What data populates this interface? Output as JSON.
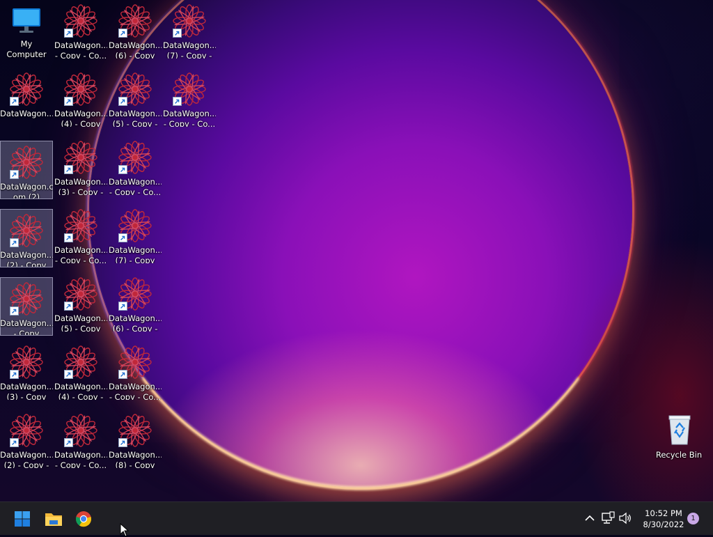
{
  "desktop": {
    "icons": [
      {
        "name": "my-computer-icon",
        "label": "My Computer",
        "type": "monitor"
      },
      {
        "name": "datawagon-shortcut-icon",
        "label": "DataWagon....\n- Copy - Co...",
        "type": "shortcut"
      },
      {
        "name": "datawagon-shortcut-icon",
        "label": "DataWagon....\n(6) - Copy",
        "type": "shortcut"
      },
      {
        "name": "datawagon-shortcut-icon",
        "label": "DataWagon....\n(7) - Copy - ...",
        "type": "shortcut"
      },
      {
        "name": "datawagon-shortcut-icon",
        "label": "DataWagon...",
        "type": "shortcut"
      },
      {
        "name": "datawagon-shortcut-icon",
        "label": "DataWagon....\n(4) - Copy",
        "type": "shortcut"
      },
      {
        "name": "datawagon-shortcut-icon",
        "label": "DataWagon....\n(5) - Copy - ...",
        "type": "shortcut"
      },
      {
        "name": "datawagon-shortcut-icon",
        "label": "DataWagon....\n- Copy - Co...",
        "type": "shortcut"
      },
      {
        "name": "datawagon-shortcut-icon",
        "label": "DataWagon.c\nom (2)",
        "type": "shortcut",
        "selected": true
      },
      {
        "name": "datawagon-shortcut-icon",
        "label": "DataWagon....\n(3) - Copy - ...",
        "type": "shortcut"
      },
      {
        "name": "datawagon-shortcut-icon",
        "label": "DataWagon....\n- Copy - Co...",
        "type": "shortcut"
      },
      {
        "name": "datawagon-shortcut-icon",
        "label": "DataWagon....\n(2) - Copy",
        "type": "shortcut",
        "selected": true
      },
      {
        "name": "datawagon-shortcut-icon",
        "label": "DataWagon....\n- Copy - Co...",
        "type": "shortcut"
      },
      {
        "name": "datawagon-shortcut-icon",
        "label": "DataWagon....\n(7) - Copy",
        "type": "shortcut"
      },
      {
        "name": "datawagon-shortcut-icon",
        "label": "DataWagon....\n- Copy",
        "type": "shortcut",
        "selected": true
      },
      {
        "name": "datawagon-shortcut-icon",
        "label": "DataWagon....\n(5) - Copy",
        "type": "shortcut"
      },
      {
        "name": "datawagon-shortcut-icon",
        "label": "DataWagon....\n(6) - Copy - ...",
        "type": "shortcut"
      },
      {
        "name": "datawagon-shortcut-icon",
        "label": "DataWagon....\n(3) - Copy",
        "type": "shortcut"
      },
      {
        "name": "datawagon-shortcut-icon",
        "label": "DataWagon....\n(4) - Copy - ...",
        "type": "shortcut"
      },
      {
        "name": "datawagon-shortcut-icon",
        "label": "DataWagon....\n- Copy - Co...",
        "type": "shortcut"
      },
      {
        "name": "datawagon-shortcut-icon",
        "label": "DataWagon....\n(2) - Copy - ...",
        "type": "shortcut"
      },
      {
        "name": "datawagon-shortcut-icon",
        "label": "DataWagon....\n- Copy - Co...",
        "type": "shortcut"
      },
      {
        "name": "datawagon-shortcut-icon",
        "label": "DataWagon....\n(8) - Copy",
        "type": "shortcut"
      },
      {
        "name": "recycle-bin-icon",
        "label": "Recycle Bin",
        "type": "recycle"
      }
    ]
  },
  "taskbar": {
    "clock": {
      "time": "10:52 PM",
      "date": "8/30/2022"
    },
    "notification_count": "1",
    "pinned": [
      "start-icon",
      "file-explorer-icon",
      "chrome-icon"
    ],
    "tray": [
      "show-hidden-icons-icon",
      "network-icon",
      "volume-icon"
    ]
  },
  "colors": {
    "taskbar": "#1f1f24",
    "selection": "#b4b4d2",
    "accent": "#0078d4"
  }
}
